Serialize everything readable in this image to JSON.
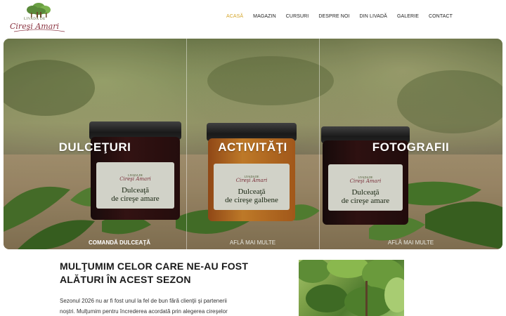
{
  "header": {
    "logo": {
      "top_text": "LIVADA DE",
      "script_text": "Cireşi Amari"
    },
    "nav": [
      {
        "label": "ACASĂ",
        "active": true
      },
      {
        "label": "MAGAZIN",
        "active": false
      },
      {
        "label": "CURSURI",
        "active": false
      },
      {
        "label": "DESPRE NOI",
        "active": false
      },
      {
        "label": "DIN LIVADĂ",
        "active": false
      },
      {
        "label": "GALERIE",
        "active": false
      },
      {
        "label": "CONTACT",
        "active": false
      }
    ]
  },
  "hero": {
    "panels": [
      {
        "title": "DULCEŢURI",
        "link": "COMANDĂ DULCEAŢĂ"
      },
      {
        "title": "ACTIVITĂŢI",
        "link": "AFLĂ MAI MULTE"
      },
      {
        "title": "FOTOGRAFII",
        "link": "AFLĂ MAI MULTE"
      }
    ],
    "jars": [
      {
        "label_top": "LIVADA DE",
        "label_script": "Cireşi Amari",
        "line1": "Dulceaţă",
        "line2": "de cireşe amare"
      },
      {
        "label_top": "LIVADA DE",
        "label_script": "Cireşi Amari",
        "line1": "Dulceaţă",
        "line2": "de cireşe galbene"
      },
      {
        "label_top": "LIVADA DE",
        "label_script": "Cireşi Amari",
        "line1": "Dulceaţă",
        "line2": "de cireşe amare"
      }
    ]
  },
  "content": {
    "title_line1": "MULŢUMIM CELOR CARE NE-AU FOST",
    "title_line2": "ALĂTURI ÎN ACEST SEZON",
    "text_line1": "Sezonul 2026 nu ar fi fost unul la fel de bun fără clienţii şi partenerii",
    "text_line2": "noştri. Mulţumim pentru încrederea acordată prin alegerea cireşelor"
  },
  "colors": {
    "accent": "#d4a52a",
    "logo_script": "#8a3340",
    "logo_tree": "#5a8a3a"
  }
}
